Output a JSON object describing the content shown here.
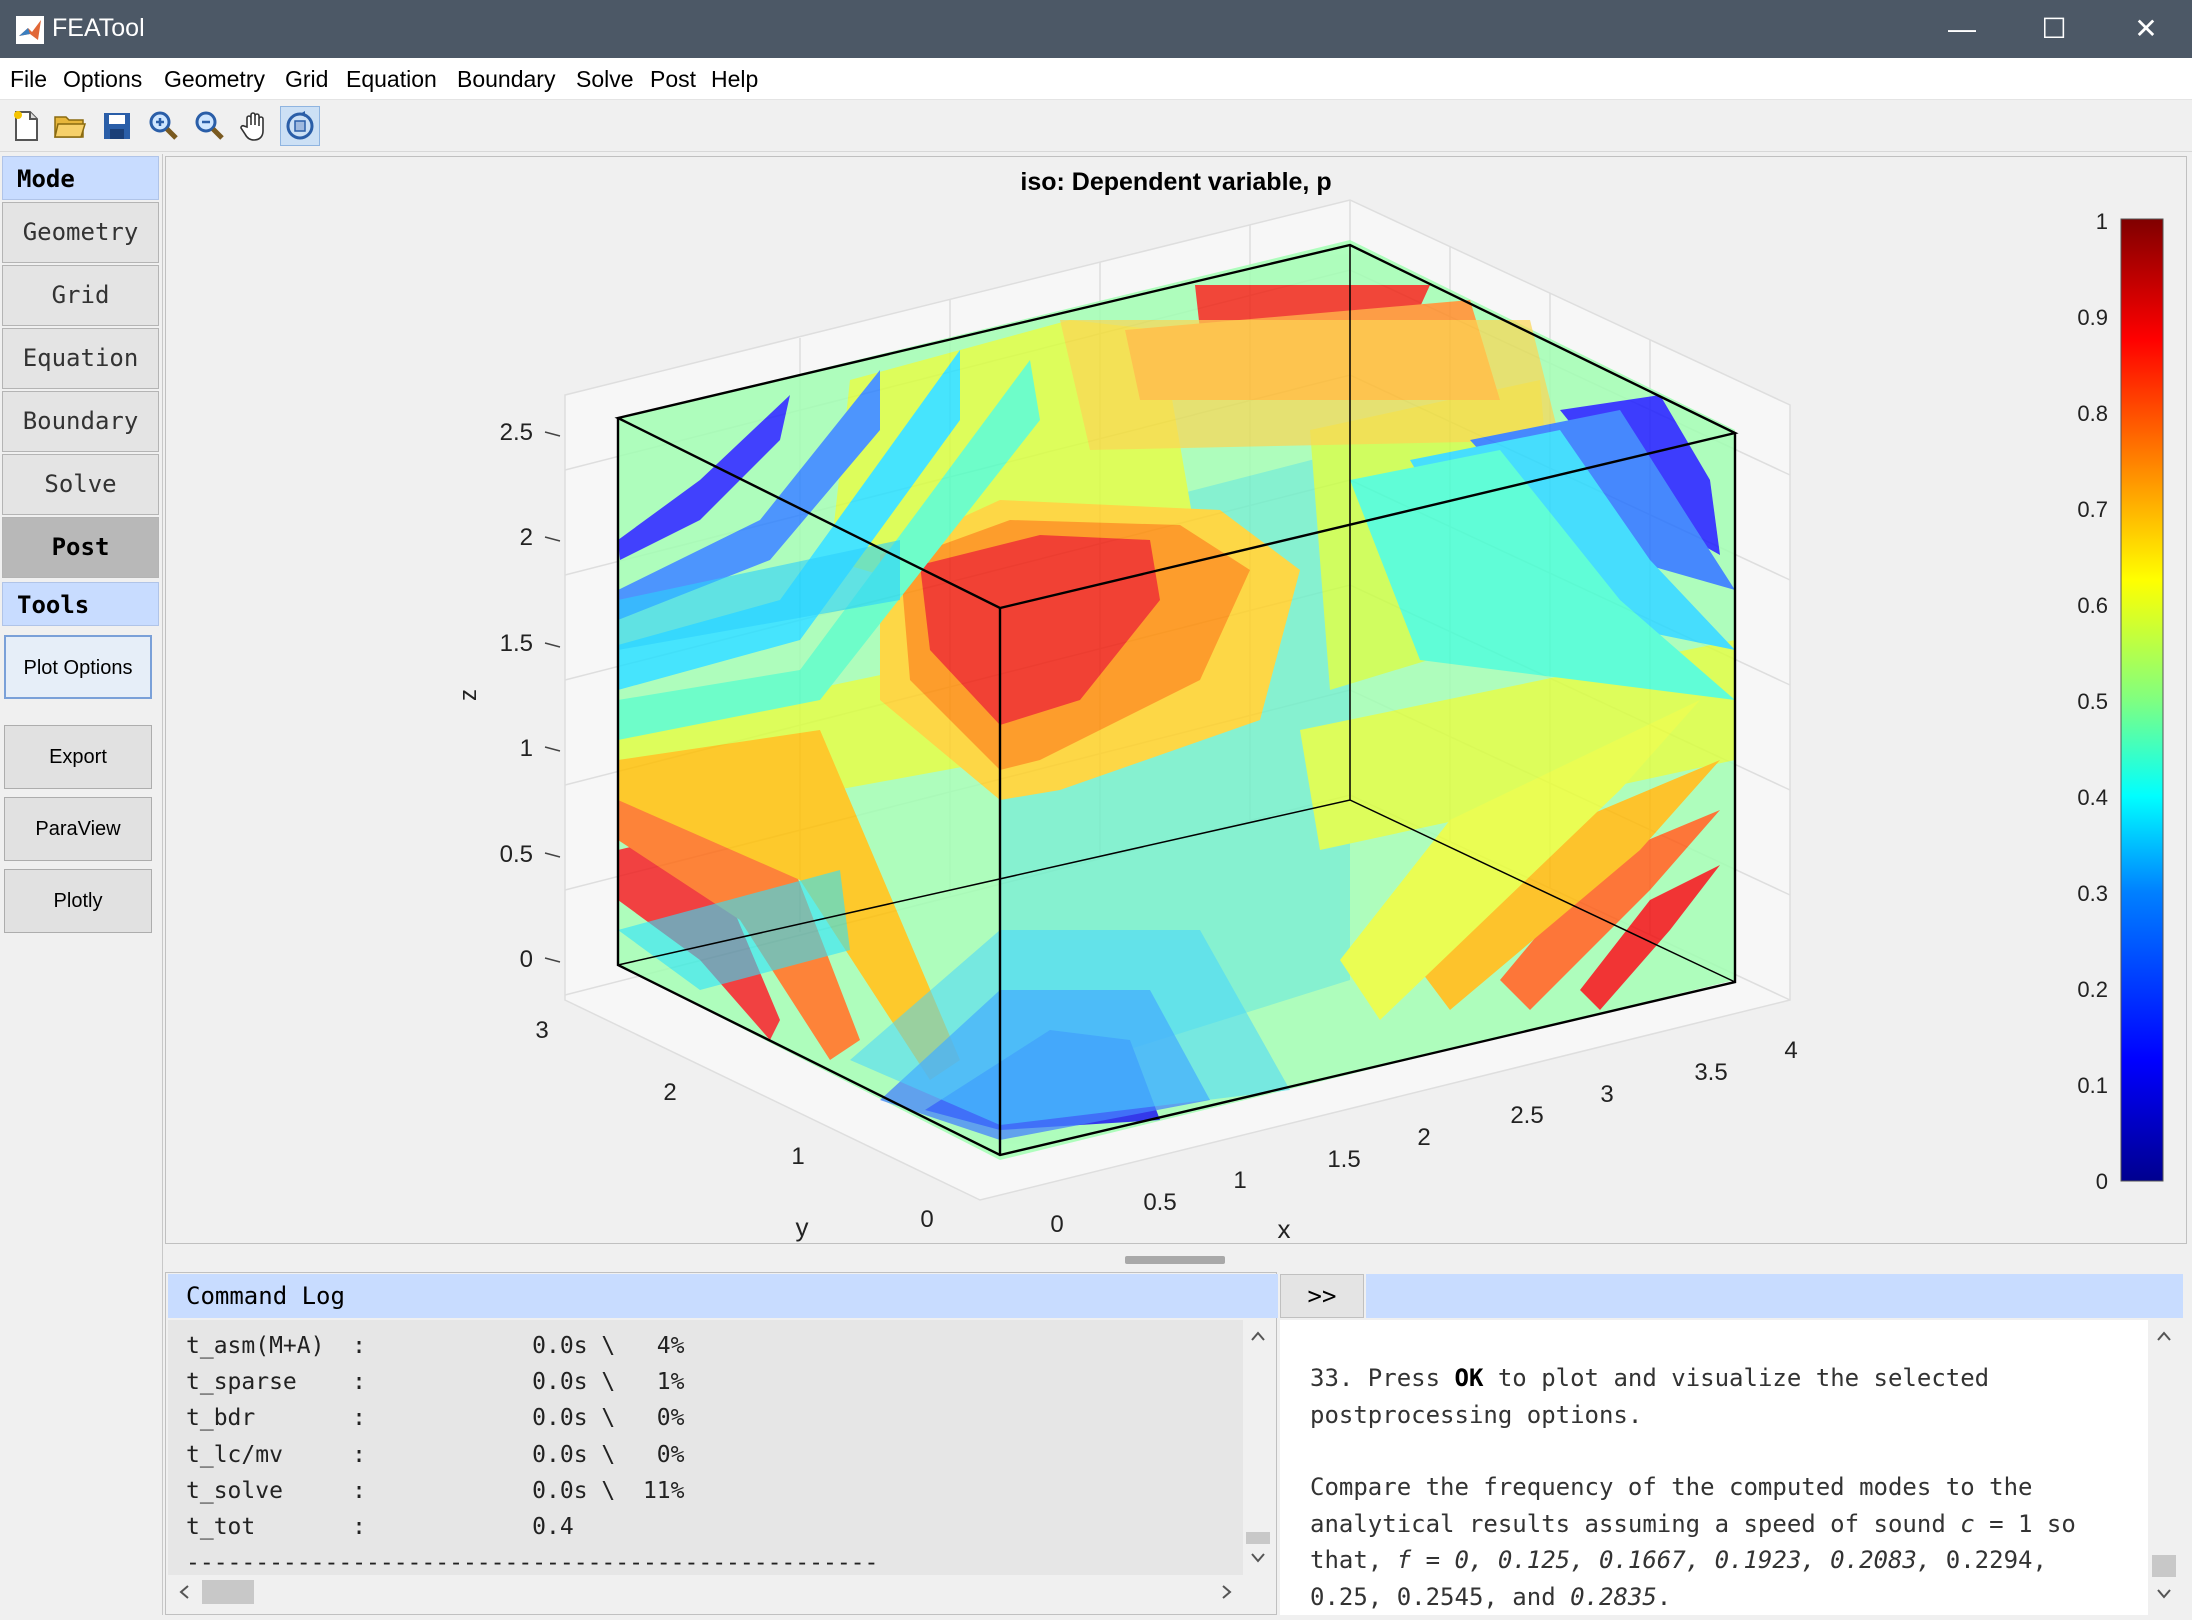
{
  "window": {
    "title": "FEATool",
    "minimize_glyph": "—",
    "maximize_glyph": "☐",
    "close_glyph": "✕"
  },
  "menu": [
    "File",
    "Options",
    "Geometry",
    "Grid",
    "Equation",
    "Boundary",
    "Solve",
    "Post",
    "Help"
  ],
  "toolbar_icons": [
    "new-file-icon",
    "open-folder-icon",
    "save-icon",
    "zoom-in-icon",
    "zoom-out-icon",
    "pan-hand-icon",
    "rotate-icon"
  ],
  "sidebar": {
    "mode_header": "Mode",
    "modes": [
      "Geometry",
      "Grid",
      "Equation",
      "Boundary",
      "Solve",
      "Post"
    ],
    "active_mode": "Post",
    "tools_header": "Tools",
    "tools": [
      "Plot Options",
      "Export",
      "ParaView",
      "Plotly"
    ]
  },
  "plot": {
    "title": "iso: Dependent variable, p",
    "xlabel": "x",
    "ylabel": "y",
    "zlabel": "z",
    "x_ticks": [
      "0",
      "0.5",
      "1",
      "1.5",
      "2",
      "2.5",
      "3",
      "3.5",
      "4"
    ],
    "y_ticks": [
      "0",
      "1",
      "2",
      "3"
    ],
    "z_ticks": [
      "0",
      "0.5",
      "1",
      "1.5",
      "2",
      "2.5"
    ],
    "colorbar_ticks": [
      "0",
      "0.1",
      "0.2",
      "0.3",
      "0.4",
      "0.5",
      "0.6",
      "0.7",
      "0.8",
      "0.9",
      "1"
    ],
    "colormap": [
      "#00008f",
      "#0000ff",
      "#0080ff",
      "#00ffff",
      "#80ff80",
      "#ffff00",
      "#ff8000",
      "#ff0000",
      "#800000"
    ]
  },
  "command_log": {
    "title": "Command Log",
    "lines": [
      "t_asm(M+A)  :            0.0s \\   4%",
      "t_sparse    :            0.0s \\   1%",
      "t_bdr       :            0.0s \\   0%",
      "t_lc/mv     :            0.0s \\   0%",
      "t_solve     :            0.0s \\  11%",
      "t_tot       :            0.4",
      "--------------------------------------------------"
    ]
  },
  "help": {
    "expand_label": ">>",
    "step_a": "33. Press ",
    "step_b": "OK",
    "step_c": " to plot and visualize the selected postprocessing options.",
    "compare_1": "Compare the frequency of the computed modes to the analytical results assuming a speed of sound ",
    "compare_c": "c",
    "compare_2": " = 1 so that, ",
    "compare_f": "f = 0, 0.125, 0.1667, 0.1923, 0.2083,",
    "compare_3": " 0.2294, 0.25, 0.2545, and ",
    "compare_last": "0.2835",
    "compare_end": "."
  }
}
